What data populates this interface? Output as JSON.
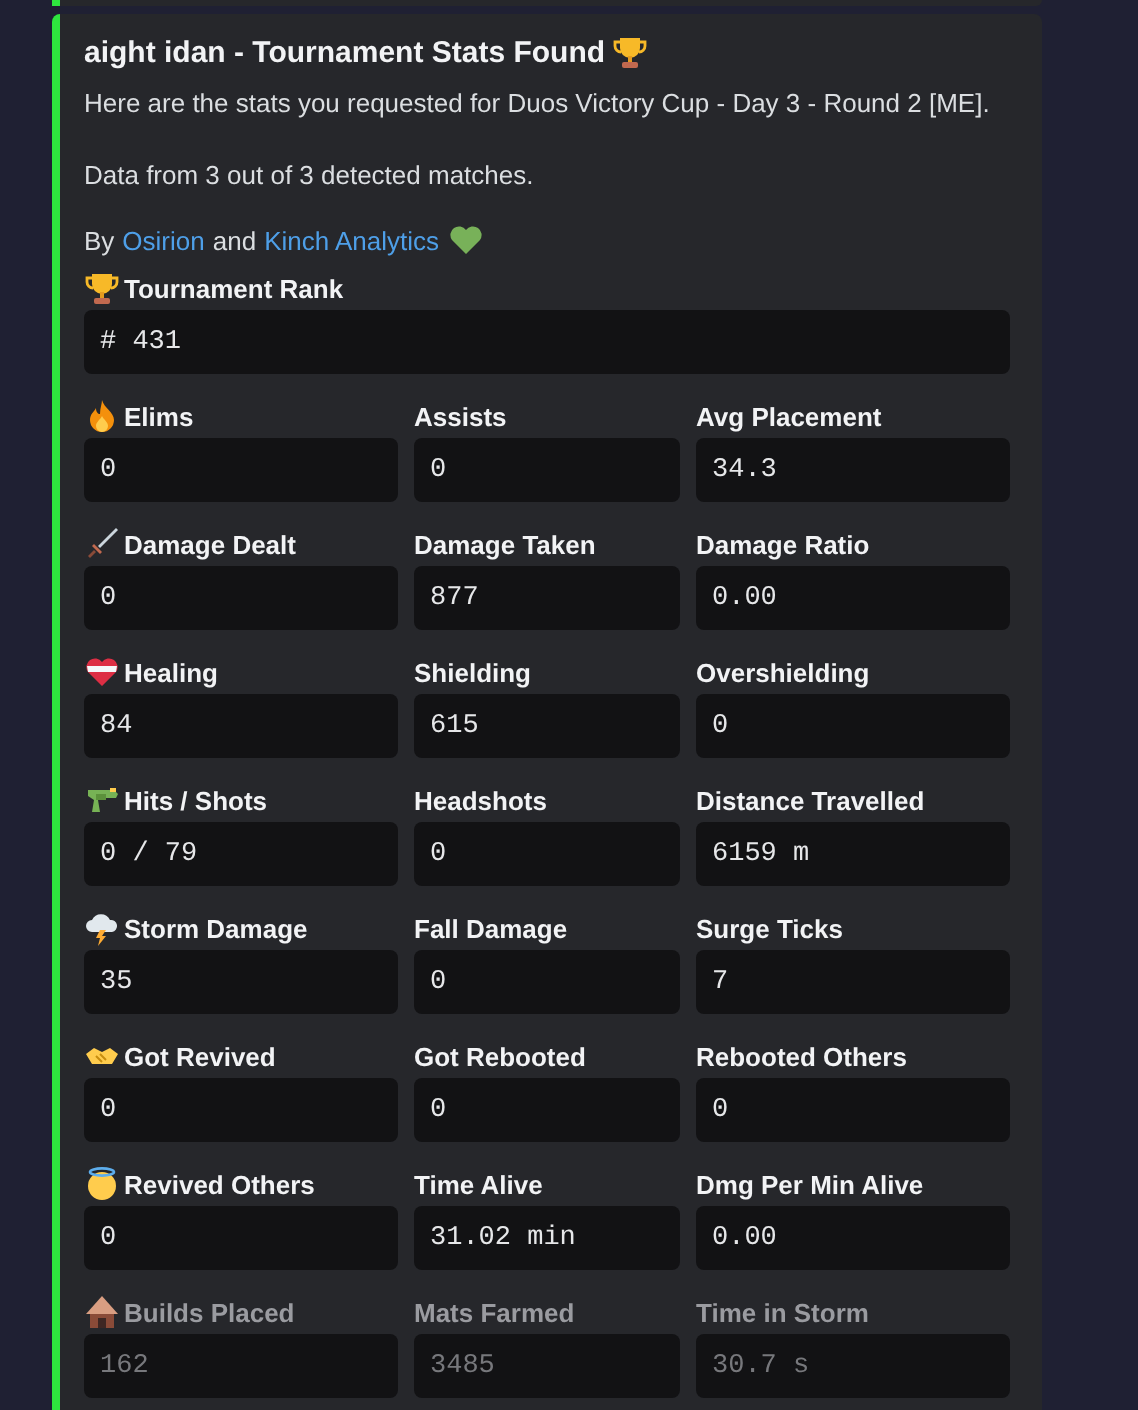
{
  "embed": {
    "title": "aight idan - Tournament Stats Found",
    "description": [
      "Here are the stats you requested for Duos Victory Cup - Day 3 - Round 2 [ME].",
      "Data from 3 out of 3 detected matches."
    ],
    "credit": {
      "prefix": "By",
      "joiner": "and",
      "links": [
        "Osirion",
        "Kinch Analytics"
      ]
    },
    "rank": {
      "label": "Tournament Rank",
      "value": "# 431"
    },
    "rows": [
      {
        "dimmed": false,
        "fields": [
          {
            "label": "Elims",
            "value": "0"
          },
          {
            "label": "Assists",
            "value": "0"
          },
          {
            "label": "Avg Placement",
            "value": "34.3"
          }
        ]
      },
      {
        "dimmed": false,
        "fields": [
          {
            "label": "Damage Dealt",
            "value": "0"
          },
          {
            "label": "Damage Taken",
            "value": "877"
          },
          {
            "label": "Damage Ratio",
            "value": "0.00"
          }
        ]
      },
      {
        "dimmed": false,
        "fields": [
          {
            "label": "Healing",
            "value": "84"
          },
          {
            "label": "Shielding",
            "value": "615"
          },
          {
            "label": "Overshielding",
            "value": "0"
          }
        ]
      },
      {
        "dimmed": false,
        "fields": [
          {
            "label": "Hits / Shots",
            "value": "0 / 79"
          },
          {
            "label": "Headshots",
            "value": "0"
          },
          {
            "label": "Distance Travelled",
            "value": "6159 m"
          }
        ]
      },
      {
        "dimmed": false,
        "fields": [
          {
            "label": "Storm Damage",
            "value": "35"
          },
          {
            "label": "Fall Damage",
            "value": "0"
          },
          {
            "label": "Surge Ticks",
            "value": "7"
          }
        ]
      },
      {
        "dimmed": false,
        "fields": [
          {
            "label": "Got Revived",
            "value": "0"
          },
          {
            "label": "Got Rebooted",
            "value": "0"
          },
          {
            "label": "Rebooted Others",
            "value": "0"
          }
        ]
      },
      {
        "dimmed": false,
        "fields": [
          {
            "label": "Revived Others",
            "value": "0"
          },
          {
            "label": "Time Alive",
            "value": "31.02 min"
          },
          {
            "label": "Dmg Per Min Alive",
            "value": "0.00"
          }
        ]
      },
      {
        "dimmed": true,
        "fields": [
          {
            "label": "Builds Placed",
            "value": "162"
          },
          {
            "label": "Mats Farmed",
            "value": "3485"
          },
          {
            "label": "Time in Storm",
            "value": "30.7 s"
          }
        ]
      }
    ]
  }
}
